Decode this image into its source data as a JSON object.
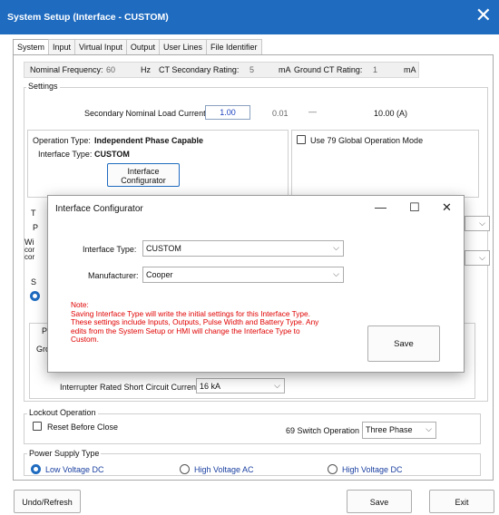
{
  "window": {
    "title": "System Setup (Interface - CUSTOM)",
    "close": "✕"
  },
  "tabs": [
    "System",
    "Input",
    "Virtual Input",
    "Output",
    "User Lines",
    "File Identifier"
  ],
  "nominal": {
    "freq_label": "Nominal Frequency:",
    "freq_value": "60",
    "freq_unit": "Hz",
    "ct_label": "CT Secondary Rating:",
    "ct_value": "5",
    "ct_unit": "mA",
    "ground_label": "Ground CT Rating:",
    "ground_value": "1",
    "ground_unit": "mA"
  },
  "settings": {
    "label": "Settings",
    "load_label": "Secondary Nominal Load Current",
    "load_value": "1.00",
    "load_min": "0.01",
    "load_dash": "—",
    "load_max": "10.00 (A)",
    "operation_label": "Operation Type:",
    "operation_value": "Independent Phase Capable",
    "interface_label": "Interface Type:",
    "interface_value": "CUSTOM",
    "configurator_btn_line1": "Interface",
    "configurator_btn_line2": "Configurator",
    "use79_label": "Use 79 Global Operation Mode",
    "hidden_t": "T",
    "hidden_p": "P",
    "hidden_wi": "Wi",
    "hidden_co1": "cor",
    "hidden_co2": "cor",
    "hidden_s": "S",
    "hidden_pl": "Pl",
    "hidden_gro": "Gro",
    "interrupter_label": "Interrupter Rated Short Circuit Current",
    "interrupter_value": "16 kA"
  },
  "lockout": {
    "label": "Lockout Operation",
    "reset_label": "Reset Before Close",
    "switch_label": "69 Switch Operation",
    "switch_value": "Three Phase"
  },
  "power": {
    "label": "Power Supply Type",
    "options": [
      "Low Voltage DC",
      "High Voltage AC",
      "High Voltage DC"
    ]
  },
  "footer": {
    "undo": "Undo/Refresh",
    "save": "Save",
    "exit": "Exit"
  },
  "dialog": {
    "title": "Interface Configurator",
    "minimize": "—",
    "maximize": "☐",
    "close": "✕",
    "interface_label": "Interface Type:",
    "interface_value": "CUSTOM",
    "manufacturer_label": "Manufacturer:",
    "manufacturer_value": "Cooper",
    "note_lines": [
      "Note:",
      "Saving Interface Type will write the initial settings for this Interface Type.",
      "These settings include Inputs, Outputs, Pulse Width and Battery Type. Any",
      "edits from the System Setup or HMI will change the Interface Type to",
      "Custom."
    ],
    "save": "Save"
  }
}
